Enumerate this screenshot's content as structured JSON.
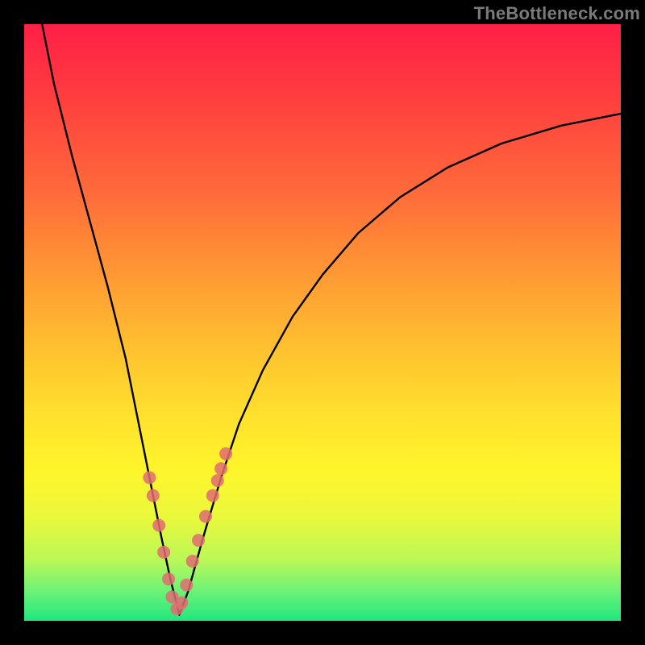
{
  "watermark": "TheBottleneck.com",
  "chart_data": {
    "type": "line",
    "title": "",
    "xlabel": "",
    "ylabel": "",
    "xlim": [
      0,
      100
    ],
    "ylim": [
      0,
      100
    ],
    "grid": false,
    "legend": false,
    "series": [
      {
        "name": "bottleneck-curve",
        "x": [
          3,
          5,
          8,
          11,
          14,
          17,
          19,
          21,
          23,
          24.5,
          26,
          27.5,
          30,
          33,
          36,
          40,
          45,
          50,
          56,
          63,
          71,
          80,
          90,
          100
        ],
        "values": [
          100,
          90,
          78,
          67,
          56,
          44,
          34,
          24,
          14,
          7,
          1,
          5,
          14,
          24,
          33,
          42,
          51,
          58,
          65,
          71,
          76,
          80,
          83,
          85
        ]
      }
    ],
    "scatter_points": {
      "name": "highlight-dots",
      "color": "#e06c72",
      "x": [
        21.0,
        21.6,
        22.6,
        23.4,
        24.2,
        24.8,
        25.6,
        26.4,
        27.2,
        28.2,
        29.2,
        30.4,
        31.6,
        32.4,
        33.0,
        33.8
      ],
      "y": [
        24.0,
        21.0,
        16.0,
        11.5,
        7.0,
        4.0,
        2.0,
        3.0,
        6.0,
        10.0,
        13.5,
        17.5,
        21.0,
        23.5,
        25.5,
        28.0
      ]
    },
    "gradient_stops": [
      {
        "pos": 0,
        "color": "#ff1f47"
      },
      {
        "pos": 28,
        "color": "#ff6a3a"
      },
      {
        "pos": 55,
        "color": "#ffc32f"
      },
      {
        "pos": 75,
        "color": "#fff52c"
      },
      {
        "pos": 100,
        "color": "#20e77f"
      }
    ]
  }
}
